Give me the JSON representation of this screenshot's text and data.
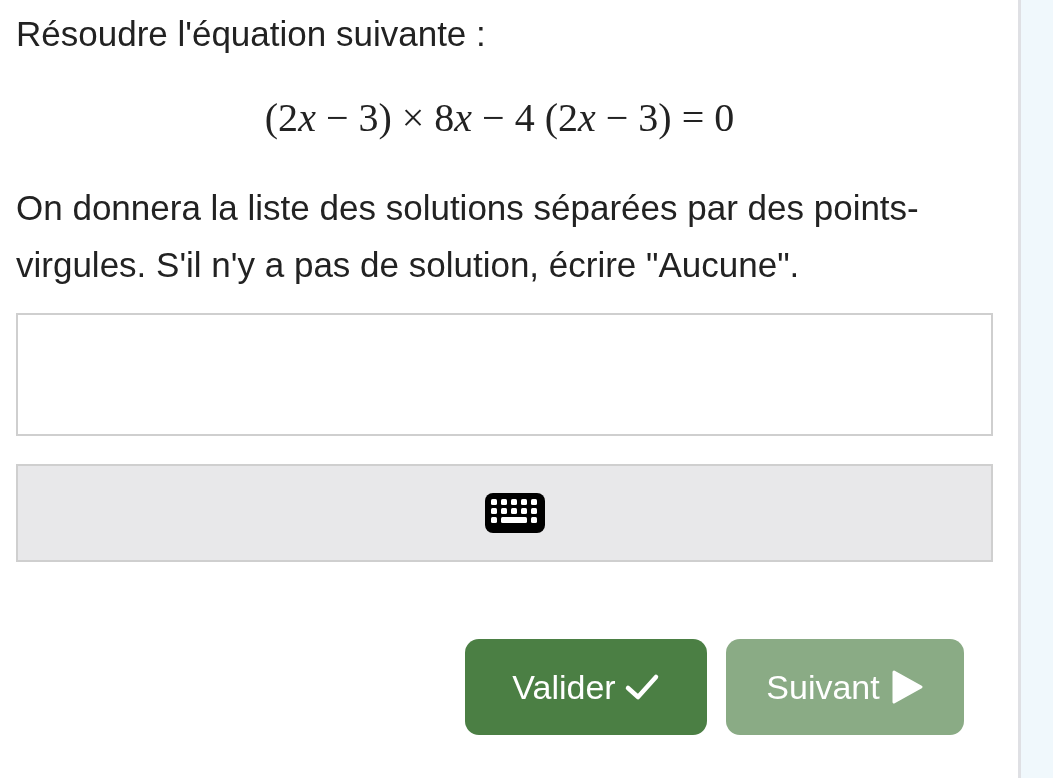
{
  "prompt": "Résoudre l'équation suivante :",
  "equation": "(2x − 3) × 8x − 4 (2x − 3) = 0",
  "instructions": "On donnera la liste des solutions séparées par des points-virgules. S'il n'y a pas de solution, écrire \"Aucune\".",
  "buttons": [
    {
      "label": "Valider",
      "kind": "validate",
      "disabled": false
    },
    {
      "label": "Suivant",
      "kind": "next",
      "disabled": true
    }
  ]
}
